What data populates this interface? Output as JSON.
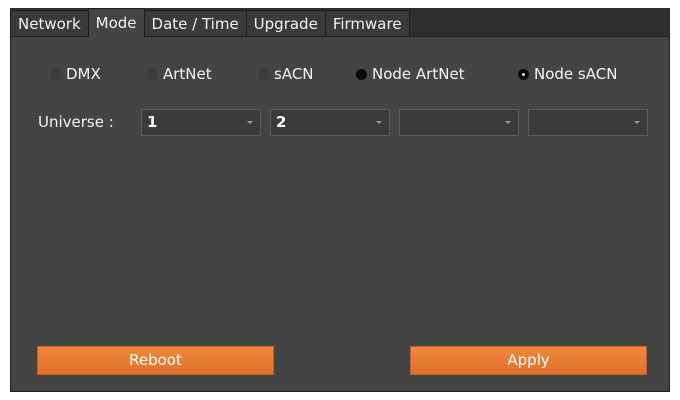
{
  "tabs": [
    {
      "label": "Network",
      "active": false
    },
    {
      "label": "Mode",
      "active": true
    },
    {
      "label": "Date / Time",
      "active": false
    },
    {
      "label": "Upgrade",
      "active": false
    },
    {
      "label": "Firmware",
      "active": false
    }
  ],
  "mode": {
    "options": [
      {
        "label": "DMX",
        "selected": false
      },
      {
        "label": "ArtNet",
        "selected": false
      },
      {
        "label": "sACN",
        "selected": false
      },
      {
        "label": "Node ArtNet",
        "selected": false
      },
      {
        "label": "Node sACN",
        "selected": true
      }
    ]
  },
  "universe": {
    "label": "Universe :",
    "values": [
      "1",
      "2",
      "",
      ""
    ]
  },
  "buttons": {
    "reboot": "Reboot",
    "apply": "Apply"
  },
  "colors": {
    "accent": "#e87a31",
    "panel": "#444444",
    "tab_bar": "#2f2f2f"
  }
}
